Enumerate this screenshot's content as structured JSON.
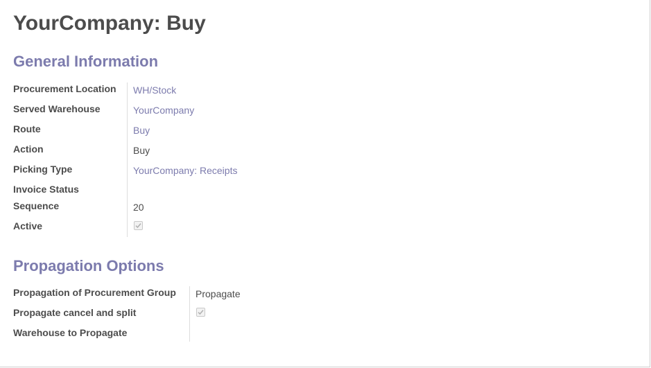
{
  "page": {
    "title": "YourCompany: Buy"
  },
  "general_information": {
    "heading": "General Information",
    "fields": [
      {
        "label": "Procurement Location",
        "value": "WH/Stock",
        "link": true
      },
      {
        "label": "Served Warehouse",
        "value": "YourCompany",
        "link": true
      },
      {
        "label": "Route",
        "value": "Buy",
        "link": true
      },
      {
        "label": "Action",
        "value": "Buy",
        "link": false
      },
      {
        "label": "Picking Type",
        "value": "YourCompany: Receipts",
        "link": true
      },
      {
        "label": "Invoice Status",
        "value": "",
        "link": false
      },
      {
        "label": "Sequence",
        "value": "20",
        "link": false
      },
      {
        "label": "Active",
        "value": "",
        "checkbox": true,
        "checked": true
      }
    ]
  },
  "propagation_options": {
    "heading": "Propagation Options",
    "fields": [
      {
        "label": "Propagation of Procurement Group",
        "value": "Propagate",
        "link": false
      },
      {
        "label": "Propagate cancel and split",
        "value": "",
        "checkbox": true,
        "checked": true
      },
      {
        "label": "Warehouse to Propagate",
        "value": "",
        "link": false
      }
    ]
  },
  "colors": {
    "title_text": "#4c4c4c",
    "section_heading": "#7c7bad",
    "link_text": "#7c7bad",
    "divider": "#dcdcdc"
  }
}
